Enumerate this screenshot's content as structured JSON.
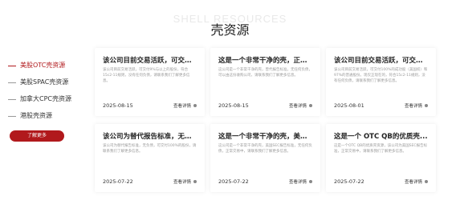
{
  "header": {
    "watermark": "SHELL RESOURCES",
    "title": "壳资源"
  },
  "sidebar": {
    "items": [
      {
        "label": "美股OTC壳资源"
      },
      {
        "label": "美股SPAC壳资源"
      },
      {
        "label": "加拿大CPC壳资源"
      },
      {
        "label": "港股壳资源"
      }
    ],
    "more_label": "了解更多"
  },
  "cards": [
    {
      "title": "该公司目前交易活跃，可交付9...",
      "desc": "该公司目前交易活跃，可交付9%与以上的股份，符合15c2-11规则，没有任何负债，请联系我们了解更多信息。",
      "date": "2025-08-15",
      "more": "查看详情"
    },
    {
      "title": "这是一个非常干净的壳，正常...",
      "desc": "这公司是一个非常干净的壳，曾代报告标准，无任何负债，可以由这份收购公司，请联系我们了解更多信息。",
      "date": "2025-08-15",
      "more": "查看详情"
    },
    {
      "title": "该公司目前交易活跃，可交付1...",
      "desc": "该公司目前交易活跃，可交付100%的成功股（美国权）和97%的普通股份。现仅正现在的，符合15c2-11规则，没有任何负债，请联系我们了解更多信息。",
      "date": "2025-08-01",
      "more": "查看详情"
    },
    {
      "title": "该公司为替代报告标准，无负...",
      "desc": "该公司为替代报告标准，无负债，可交付100%的股份，请联系我们了解更多信息。",
      "date": "2025-07-22",
      "more": "查看详情"
    },
    {
      "title": "这是一个非常干净的壳，美国S...",
      "desc": "这公司是一个非常干净的壳，美国SEC报告标准，无任何负债，正常交易中，请联系我们了解更多信息。",
      "date": "2025-07-22",
      "more": "查看详情"
    },
    {
      "title": "这是一个 OTC QB的优质壳...",
      "desc": "这是一个OTC QB的优质壳资源，该公司为美国SEC报告标准，正常交易中，请联系我们了解更多信息。",
      "date": "2025-07-22",
      "more": "查看详情"
    }
  ]
}
